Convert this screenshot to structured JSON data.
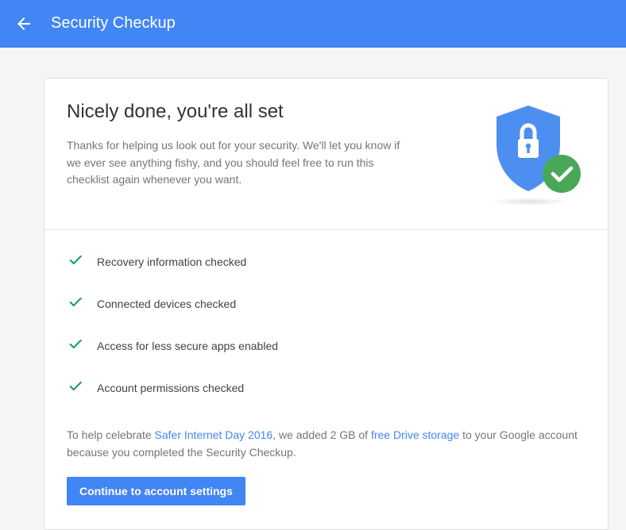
{
  "header": {
    "title": "Security Checkup"
  },
  "card": {
    "title": "Nicely done, you're all set",
    "description": "Thanks for helping us look out for your security. We'll let you know if we ever see anything fishy, and you should feel free to run this checklist again whenever you want."
  },
  "checklist": {
    "items": [
      {
        "label": "Recovery information checked"
      },
      {
        "label": "Connected devices checked"
      },
      {
        "label": "Access for less secure apps enabled"
      },
      {
        "label": "Account permissions checked"
      }
    ]
  },
  "footer": {
    "prefix": "To help celebrate ",
    "link1": "Safer Internet Day 2016",
    "mid": ", we added 2 GB of ",
    "link2": "free Drive storage",
    "suffix": " to your Google account because you completed the Security Checkup."
  },
  "button": {
    "label": "Continue to account settings"
  },
  "colors": {
    "primary": "#4285f4",
    "success": "#0f9d58",
    "badge": "#4caf50"
  }
}
